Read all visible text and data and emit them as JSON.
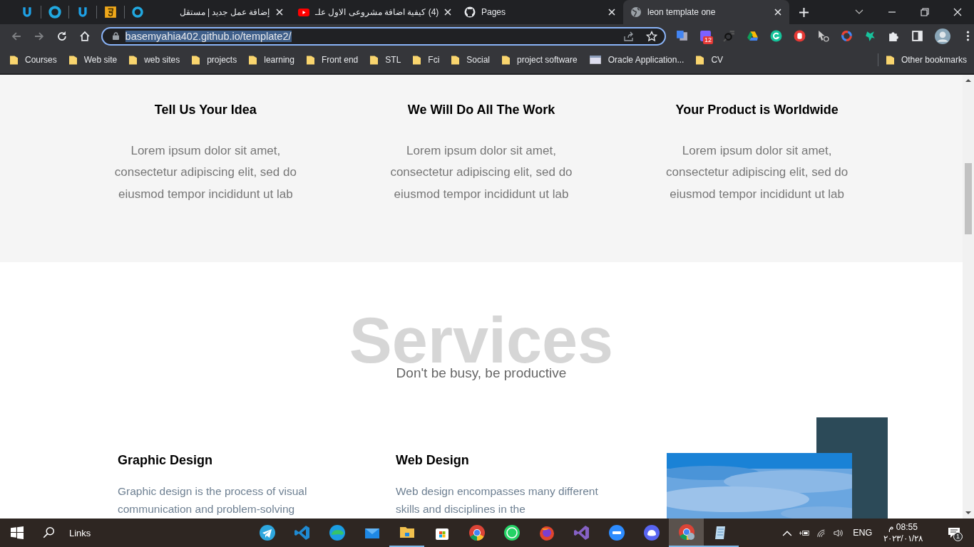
{
  "browser": {
    "tabs": [
      {
        "title": "إضافة عمل جديد | مستقل",
        "kind": "ring",
        "selected": false
      },
      {
        "title": "(4) كيفية اضافة مشروعى الاول علـ",
        "kind": "video",
        "selected": false
      },
      {
        "title": "Pages",
        "kind": "octocat",
        "selected": false
      },
      {
        "title": "leon template one",
        "kind": "globe",
        "selected": true
      }
    ],
    "address": "basemyahia402.github.io/template2/",
    "extension_badge": "12",
    "bookmarks": [
      {
        "label": "Courses",
        "kind": "folder"
      },
      {
        "label": "Web site",
        "kind": "folder"
      },
      {
        "label": "web sites",
        "kind": "folder"
      },
      {
        "label": "projects",
        "kind": "folder"
      },
      {
        "label": "learning",
        "kind": "folder"
      },
      {
        "label": "Front end",
        "kind": "folder"
      },
      {
        "label": "STL",
        "kind": "folder"
      },
      {
        "label": "Fci",
        "kind": "folder"
      },
      {
        "label": "Social",
        "kind": "folder"
      },
      {
        "label": "project software",
        "kind": "folder"
      },
      {
        "label": "Oracle Application...",
        "kind": "page"
      },
      {
        "label": "CV",
        "kind": "folder"
      }
    ],
    "other_bookmarks": "Other bookmarks"
  },
  "page": {
    "features": [
      {
        "title": "Tell Us Your Idea",
        "text": "Lorem ipsum dolor sit amet, consectetur adipiscing elit, sed do eiusmod tempor incididunt ut lab"
      },
      {
        "title": "We Will Do All The Work",
        "text": "Lorem ipsum dolor sit amet, consectetur adipiscing elit, sed do eiusmod tempor incididunt ut lab"
      },
      {
        "title": "Your Product is Worldwide",
        "text": "Lorem ipsum dolor sit amet, consectetur adipiscing elit, sed do eiusmod tempor incididunt ut lab"
      }
    ],
    "services": {
      "title": "Services",
      "subtitle": "Don't be busy, be productive",
      "items": [
        {
          "title": "Graphic Design",
          "text": "Graphic design is the process of visual communication and problem-solving"
        },
        {
          "title": "Web Design",
          "text": "Web design encompasses many different skills and disciplines in the"
        }
      ]
    }
  },
  "taskbar": {
    "search_label": "Links",
    "language": "ENG",
    "time": "08:55 م",
    "date": "٢٠٢٣/٠١/٢٨",
    "notifications": "1"
  }
}
